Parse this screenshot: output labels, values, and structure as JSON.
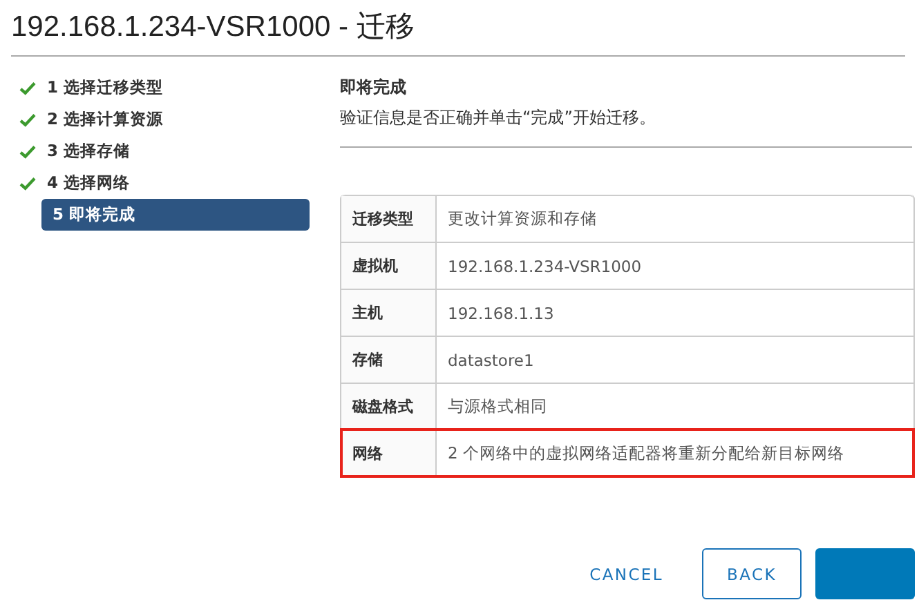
{
  "window": {
    "title": "192.168.1.234-VSR1000 - 迁移"
  },
  "steps": [
    {
      "label": "1 选择迁移类型",
      "done": true,
      "selected": false
    },
    {
      "label": "2 选择计算资源",
      "done": true,
      "selected": false
    },
    {
      "label": "3 选择存储",
      "done": true,
      "selected": false
    },
    {
      "label": "4 选择网络",
      "done": true,
      "selected": false
    },
    {
      "label": "5 即将完成",
      "done": false,
      "selected": true
    }
  ],
  "page": {
    "heading": "即将完成",
    "description": "验证信息是否正确并单击“完成”开始迁移。"
  },
  "table": {
    "rows": [
      {
        "label": "迁移类型",
        "value": "更改计算资源和存储",
        "highlighted": false
      },
      {
        "label": "虚拟机",
        "value": "192.168.1.234-VSR1000",
        "highlighted": false
      },
      {
        "label": "主机",
        "value": "192.168.1.13",
        "highlighted": false
      },
      {
        "label": "存储",
        "value": "datastore1",
        "highlighted": false
      },
      {
        "label": "磁盘格式",
        "value": "与源格式相同",
        "highlighted": false
      },
      {
        "label": "网络",
        "value": "2 个网络中的虚拟网络适配器将重新分配给新目标网络",
        "highlighted": true
      }
    ]
  },
  "buttons": [
    {
      "label": "CANCEL",
      "kind": "flat"
    },
    {
      "label": "BACK",
      "kind": "outline"
    },
    {
      "kind": "primary"
    }
  ]
}
